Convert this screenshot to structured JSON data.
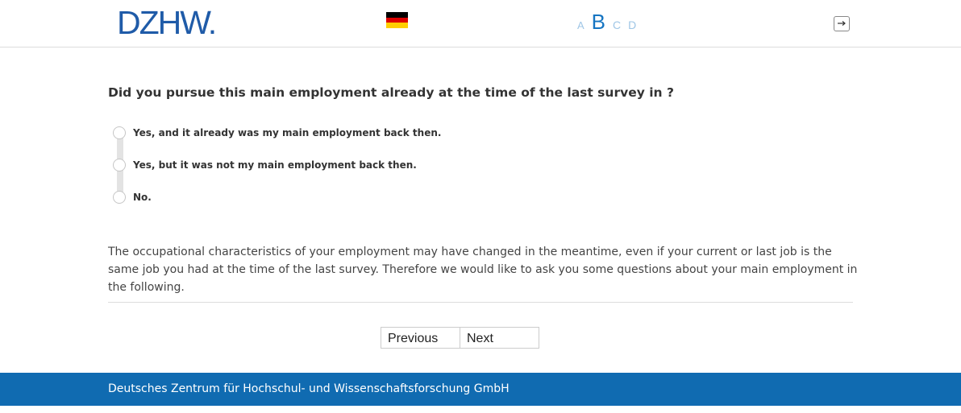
{
  "header": {
    "logo_text": "DZHW.",
    "language_flag": "germany-flag-icon",
    "font_size_options": [
      "A",
      "B",
      "C",
      "D"
    ],
    "logout_icon": "logout-icon"
  },
  "question": {
    "text": "Did you pursue this main employment already at the time of the last survey in ?",
    "options": [
      "Yes, and it already was my main employment back then.",
      "Yes, but it was not my main employment back then.",
      "No."
    ]
  },
  "info_text": "The occupational characteristics of your employment may have changed in the meantime, even if your current or last job is the same job you had at the time of the last survey. Therefore we would like to ask you some questions about your main employment in the following.",
  "navigation": {
    "previous_label": "Previous",
    "next_label": "Next"
  },
  "footer": {
    "text": "Deutsches Zentrum für Hochschul- und Wissenschaftsforschung GmbH"
  },
  "colors": {
    "brand_blue": "#1f5ba8",
    "footer_blue": "#106bb1",
    "active_font_size": "#1675c2"
  }
}
